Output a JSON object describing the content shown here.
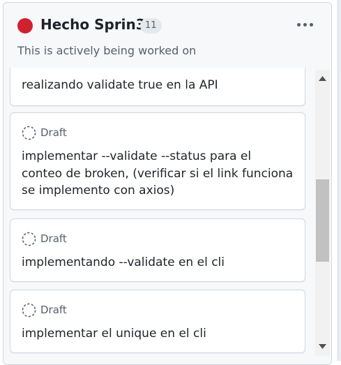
{
  "column": {
    "title": "Hecho Sprin3",
    "count": "11",
    "description": "This is actively being worked on",
    "status_color": "#cf222e"
  },
  "cards": [
    {
      "draft_label": "",
      "text": "realizando validate true en la API"
    },
    {
      "draft_label": "Draft",
      "text": "implementar --validate --status para el conteo de broken, (verificar si el link funciona se implemento con axios)"
    },
    {
      "draft_label": "Draft",
      "text": "implementando --validate en el cli"
    },
    {
      "draft_label": "Draft",
      "text": "implementar el unique en el cli"
    }
  ],
  "icons": {
    "more": "kebab-horizontal-icon",
    "draft": "draft-issue-icon",
    "scroll_up": "triangle-up-icon",
    "scroll_down": "triangle-down-icon"
  }
}
